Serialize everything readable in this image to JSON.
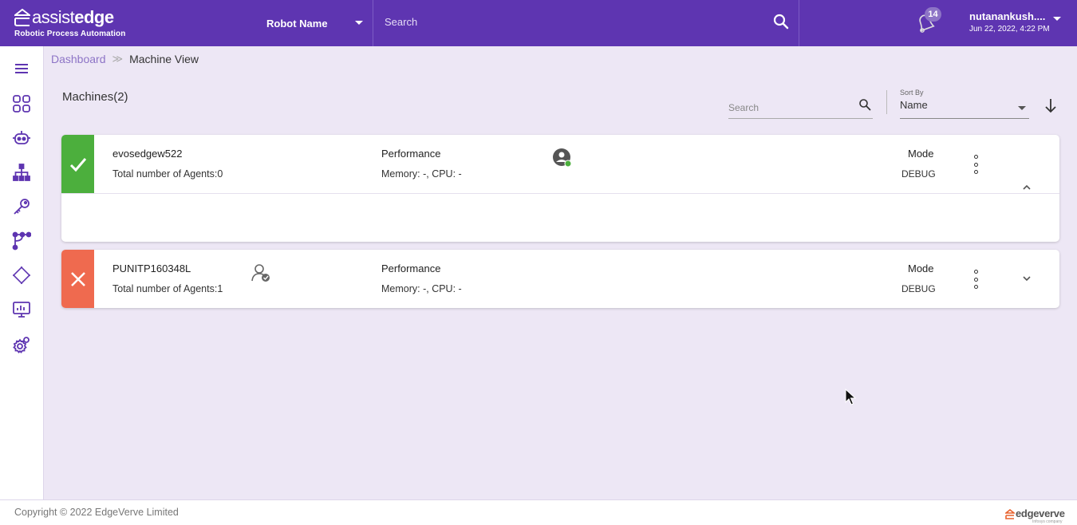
{
  "app": {
    "logo_light": "assist",
    "logo_bold": "edge",
    "logo_subtitle": "Robotic Process Automation"
  },
  "header": {
    "robot_select_value": "Robot Name",
    "search_placeholder": "Search",
    "notification_count": "14",
    "user_name": "nutanankush....",
    "user_datetime": "Jun 22, 2022, 4:22 PM"
  },
  "sidebar": {
    "items": [
      "menu-icon",
      "dashboard-grid-icon",
      "robot-icon",
      "hierarchy-icon",
      "key-icon",
      "workflow-icon",
      "chip-icon",
      "monitor-chart-icon",
      "settings-gear-icon"
    ]
  },
  "breadcrumb": {
    "root": "Dashboard",
    "current": "Machine View"
  },
  "list": {
    "title": "Machines(2)",
    "search_placeholder": "Search",
    "sort_label": "Sort By",
    "sort_value": "Name"
  },
  "machines": [
    {
      "name": "evosedgew522",
      "agents": "Total number of Agents:0",
      "status": "success",
      "performance_label": "Performance",
      "performance_value": "Memory: -, CPU: -",
      "mode_label": "Mode",
      "mode_value": "DEBUG",
      "expanded": true
    },
    {
      "name": "PUNITP160348L",
      "agents": "Total number of Agents:1",
      "status": "error",
      "performance_label": "Performance",
      "performance_value": "Memory: -, CPU: -",
      "mode_label": "Mode",
      "mode_value": "DEBUG",
      "expanded": false
    }
  ],
  "footer": {
    "copyright": "Copyright © 2022 EdgeVerve Limited",
    "brand": "edgeverve",
    "brand_sub": "Infosys company"
  },
  "colors": {
    "primary": "#5e35b1",
    "background": "#ede7f5",
    "success": "#4caf3d",
    "error": "#ef6a4f"
  }
}
